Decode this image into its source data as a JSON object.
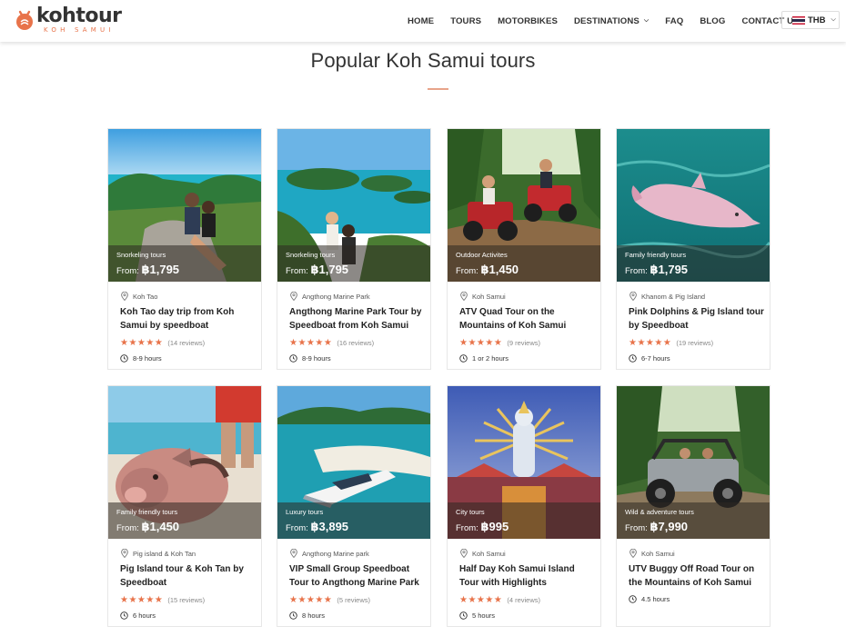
{
  "brand": {
    "name": "kohtour",
    "tagline": "KOH SAMUI"
  },
  "nav": {
    "home": "HOME",
    "tours": "TOURS",
    "motorbikes": "MOTORBIKES",
    "destinations": "DESTINATIONS",
    "faq": "FAQ",
    "blog": "BLOG",
    "contact": "CONTACT US"
  },
  "currency": {
    "label": "THB"
  },
  "section": {
    "title": "Popular Koh Samui tours"
  },
  "colors": {
    "accent": "#e8734a",
    "star": "#e8734a"
  },
  "tours": [
    {
      "category": "Snorkeling tours",
      "price_prefix": "From: ",
      "price": "฿1,795",
      "location": "Koh Tao",
      "title": "Koh Tao day trip from Koh Samui by speedboat",
      "stars": "★★★★★",
      "reviews": "(14 reviews)",
      "duration": "8-9 hours",
      "image": "couple-on-rocks-island-view"
    },
    {
      "category": "Snorkeling tours",
      "price_prefix": "From: ",
      "price": "฿1,795",
      "location": "Angthong Marine Park",
      "title": "Angthong Marine Park Tour by Speedboat from Koh Samui",
      "stars": "★★★★★",
      "reviews": "(16 reviews)",
      "duration": "8-9 hours",
      "image": "viewpoint-over-islands"
    },
    {
      "category": "Outdoor Activites",
      "price_prefix": "From: ",
      "price": "฿1,450",
      "location": "Koh Samui",
      "title": "ATV Quad Tour on the Mountains of Koh Samui",
      "stars": "★★★★★",
      "reviews": "(9 reviews)",
      "duration": "1 or 2 hours",
      "image": "atv-quads-jungle"
    },
    {
      "category": "Family friendly tours",
      "price_prefix": "From: ",
      "price": "฿1,795",
      "location": "Khanom & Pig Island",
      "title": "Pink Dolphins & Pig Island tour by Speedboat",
      "stars": "★★★★★",
      "reviews": "(19 reviews)",
      "duration": "6-7 hours",
      "image": "pink-dolphin"
    },
    {
      "category": "Family friendly tours",
      "price_prefix": "From: ",
      "price": "฿1,450",
      "location": "Pig island & Koh Tan",
      "title": "Pig Island tour & Koh Tan by Speedboat",
      "stars": "★★★★★",
      "reviews": "(15 reviews)",
      "duration": "6 hours",
      "image": "pig-on-beach"
    },
    {
      "category": "Luxury tours",
      "price_prefix": "From: ",
      "price": "฿3,895",
      "location": "Angthong Marine park",
      "title": "VIP Small Group Speedboat Tour to Angthong Marine Park",
      "stars": "★★★★★",
      "reviews": "(5 reviews)",
      "duration": "8 hours",
      "image": "speedboat-sandbar"
    },
    {
      "category": "City tours",
      "price_prefix": "From: ",
      "price": "฿995",
      "location": "Koh Samui",
      "title": "Half Day Koh Samui Island Tour with Highlights",
      "stars": "★★★★★",
      "reviews": "(4 reviews)",
      "duration": "5 hours",
      "image": "temple-statue"
    },
    {
      "category": "Wild & adventure tours",
      "price_prefix": "From: ",
      "price": "฿7,990",
      "location": "Koh Samui",
      "title": "UTV Buggy Off Road Tour on the Mountains of Koh Samui",
      "stars": "",
      "reviews": "",
      "duration": "4.5 hours",
      "image": "utv-buggy-jungle"
    }
  ]
}
